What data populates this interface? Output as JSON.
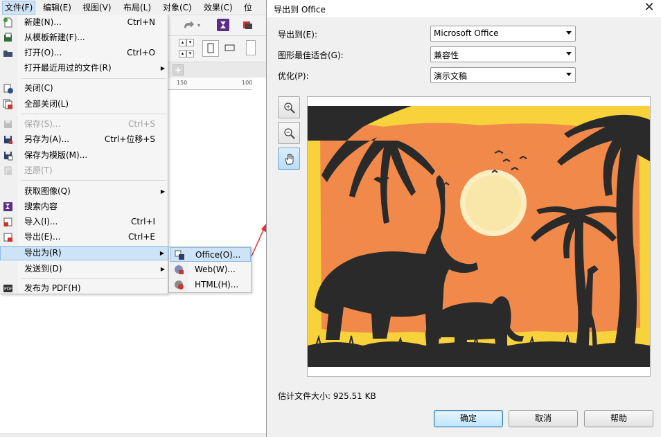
{
  "menubar": {
    "items": [
      "文件(F)",
      "编辑(E)",
      "视图(V)",
      "布局(L)",
      "对象(C)",
      "效果(C)",
      "位"
    ]
  },
  "ruler": {
    "marks": [
      "150",
      "100"
    ]
  },
  "file_menu": {
    "items": [
      {
        "label": "新建(N)...",
        "shortcut": "Ctrl+N",
        "icon": "new-document-icon"
      },
      {
        "label": "从模板新建(F)...",
        "shortcut": "",
        "icon": "new-from-template-icon"
      },
      {
        "label": "打开(O)...",
        "shortcut": "Ctrl+O",
        "icon": "open-folder-icon"
      },
      {
        "label": "打开最近用过的文件(R)",
        "shortcut": "",
        "icon": ""
      },
      {
        "label": "关闭(C)",
        "shortcut": "",
        "icon": "close-document-icon"
      },
      {
        "label": "全部关闭(L)",
        "shortcut": "",
        "icon": "close-all-icon"
      },
      {
        "label": "保存(S)...",
        "shortcut": "Ctrl+S",
        "icon": "save-icon"
      },
      {
        "label": "另存为(A)...",
        "shortcut": "Ctrl+位移+S",
        "icon": "save-as-icon"
      },
      {
        "label": "保存为模版(M)...",
        "shortcut": "",
        "icon": "save-template-icon"
      },
      {
        "label": "还原(T)",
        "shortcut": "",
        "icon": "revert-icon"
      },
      {
        "label": "获取图像(Q)",
        "shortcut": "",
        "icon": ""
      },
      {
        "label": "搜索内容",
        "shortcut": "",
        "icon": "search-content-icon"
      },
      {
        "label": "导入(I)...",
        "shortcut": "Ctrl+I",
        "icon": "import-icon"
      },
      {
        "label": "导出(E)...",
        "shortcut": "Ctrl+E",
        "icon": "export-icon"
      },
      {
        "label": "导出为(R)",
        "shortcut": "",
        "icon": ""
      },
      {
        "label": "发送到(D)",
        "shortcut": "",
        "icon": ""
      },
      {
        "label": "发布为 PDF(H)",
        "shortcut": "",
        "icon": "pdf-icon"
      }
    ]
  },
  "export_submenu": {
    "items": [
      {
        "label": "Office(O)...",
        "icon": "office-export-icon"
      },
      {
        "label": "Web(W)...",
        "icon": "web-export-icon"
      },
      {
        "label": "HTML(H)...",
        "icon": "html-export-icon"
      }
    ]
  },
  "dialog": {
    "title": "导出到 Office",
    "export_to_label": "导出到(E):",
    "export_to_value": "Microsoft Office",
    "best_fit_label": "图形最佳适合(G):",
    "best_fit_value": "兼容性",
    "optimize_label": "优化(P):",
    "optimize_value": "演示文稿",
    "tools": [
      "zoom-in-icon",
      "zoom-out-icon",
      "pan-hand-icon"
    ],
    "estimate_text": "估计文件大小: 925.51 KB",
    "ok_label": "确定",
    "cancel_label": "取消",
    "help_label": "帮助"
  },
  "colors": {
    "accent_highlight": "#cde4f7",
    "preview_orange": "#f0894a",
    "preview_yellow": "#f7d23a",
    "silhouette": "#2a2a2a",
    "arrow_red": "#e03030"
  }
}
